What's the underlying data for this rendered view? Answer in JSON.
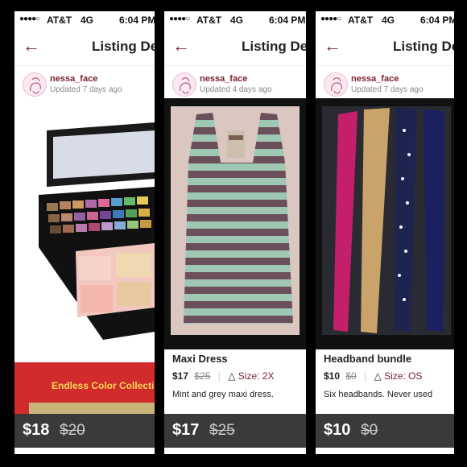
{
  "status_bar": {
    "signal": "●●●●○",
    "carrier": "AT&T",
    "network": "4G",
    "time": "6:04 PM"
  },
  "nav": {
    "back_icon": "back-arrow-icon",
    "title": "Listing Details"
  },
  "panels": [
    {
      "seller": {
        "username": "nessa_face",
        "updated": "Updated 7 days ago"
      },
      "banner_text": "Endless Color Collection",
      "bottom": {
        "price": "$18",
        "original": "$20"
      }
    },
    {
      "seller": {
        "username": "nessa_face",
        "updated": "Updated 4 days ago"
      },
      "title": "Maxi Dress",
      "price": "$17",
      "original": "$25",
      "size": "Size: 2X",
      "description": "Mint and grey maxi dress.",
      "bottom": {
        "price": "$17",
        "original": "$25"
      }
    },
    {
      "seller": {
        "username": "nessa_face",
        "updated": "Updated 7 days ago"
      },
      "title": "Headband bundle",
      "price": "$10",
      "original": "$0",
      "size": "Size: OS",
      "description": "Six headbands. Never used",
      "bottom": {
        "price": "$10",
        "original": "$0"
      }
    }
  ],
  "colors": {
    "accent": "#7b1f2f",
    "bottom_bar": "#3a3a3a"
  }
}
